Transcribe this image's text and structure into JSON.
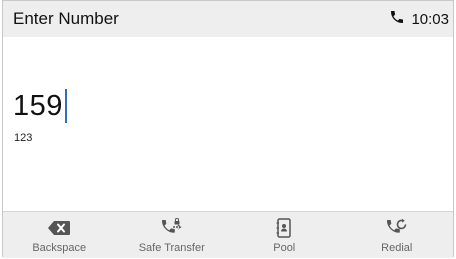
{
  "header": {
    "title": "Enter Number",
    "time": "10:03",
    "status_icon": "phone-handset-icon"
  },
  "dial": {
    "number": "159",
    "input_mode": "123"
  },
  "softkeys": [
    {
      "label": "Backspace",
      "icon": "backspace-icon"
    },
    {
      "label": "Safe Transfer",
      "icon": "safe-transfer-icon"
    },
    {
      "label": "Pool",
      "icon": "directory-icon"
    },
    {
      "label": "Redial",
      "icon": "redial-icon"
    }
  ],
  "colors": {
    "header_bg": "#eeeeee",
    "cursor": "#2f6fb6",
    "icon": "#555555"
  }
}
